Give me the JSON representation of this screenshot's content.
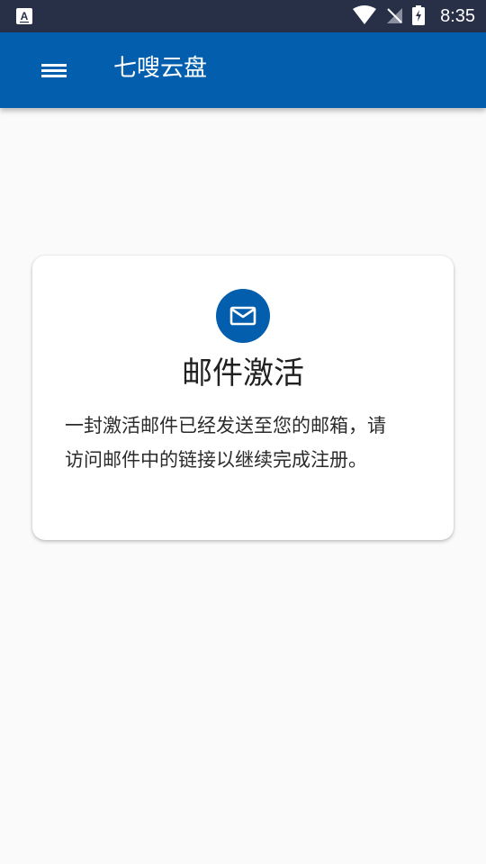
{
  "status_bar": {
    "time": "8:35",
    "icons": [
      "a-app-icon",
      "wifi-icon",
      "no-sim-icon",
      "battery-charging-icon"
    ]
  },
  "app_bar": {
    "menu_icon": "menu-icon",
    "title": "七嗖云盘",
    "color": "#035ead"
  },
  "card": {
    "icon": "mail-icon",
    "title": "邮件激活",
    "message": "一封激活邮件已经发送至您的邮箱，请访问邮件中的链接以继续完成注册。"
  }
}
